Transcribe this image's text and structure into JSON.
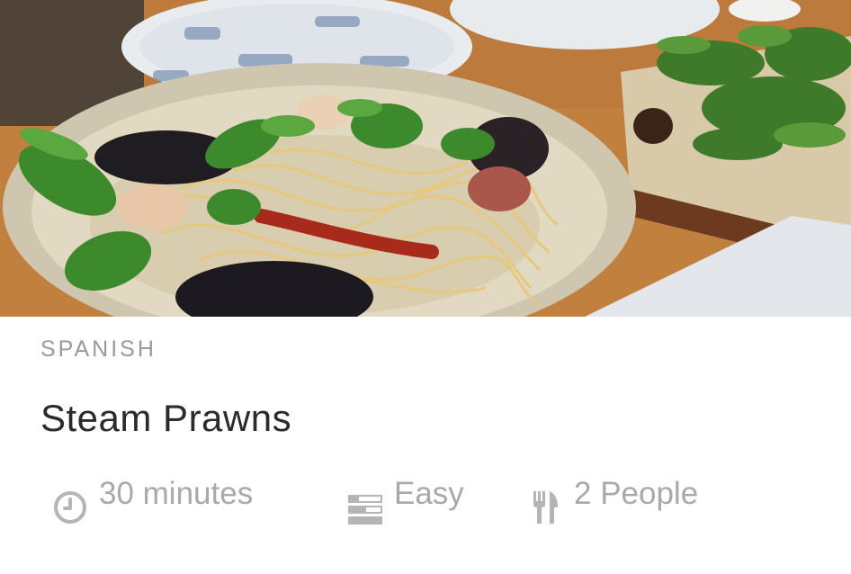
{
  "recipe": {
    "category": "SPANISH",
    "title": "Steam Prawns",
    "image_alt": "Spaghetti with prawns, mussels, dried chili and fresh herbs in a ceramic bowl"
  },
  "meta": {
    "time": {
      "icon": "clock-icon",
      "label": "30 minutes"
    },
    "difficulty": {
      "icon": "difficulty-bars-icon",
      "label": "Easy"
    },
    "servings": {
      "icon": "fork-knife-icon",
      "label": "2 People"
    }
  },
  "colors": {
    "category_text": "#9a9a9a",
    "title_text": "#2b2b2b",
    "meta_text": "#a9a9a9",
    "icon_color": "#b5b5b5"
  }
}
